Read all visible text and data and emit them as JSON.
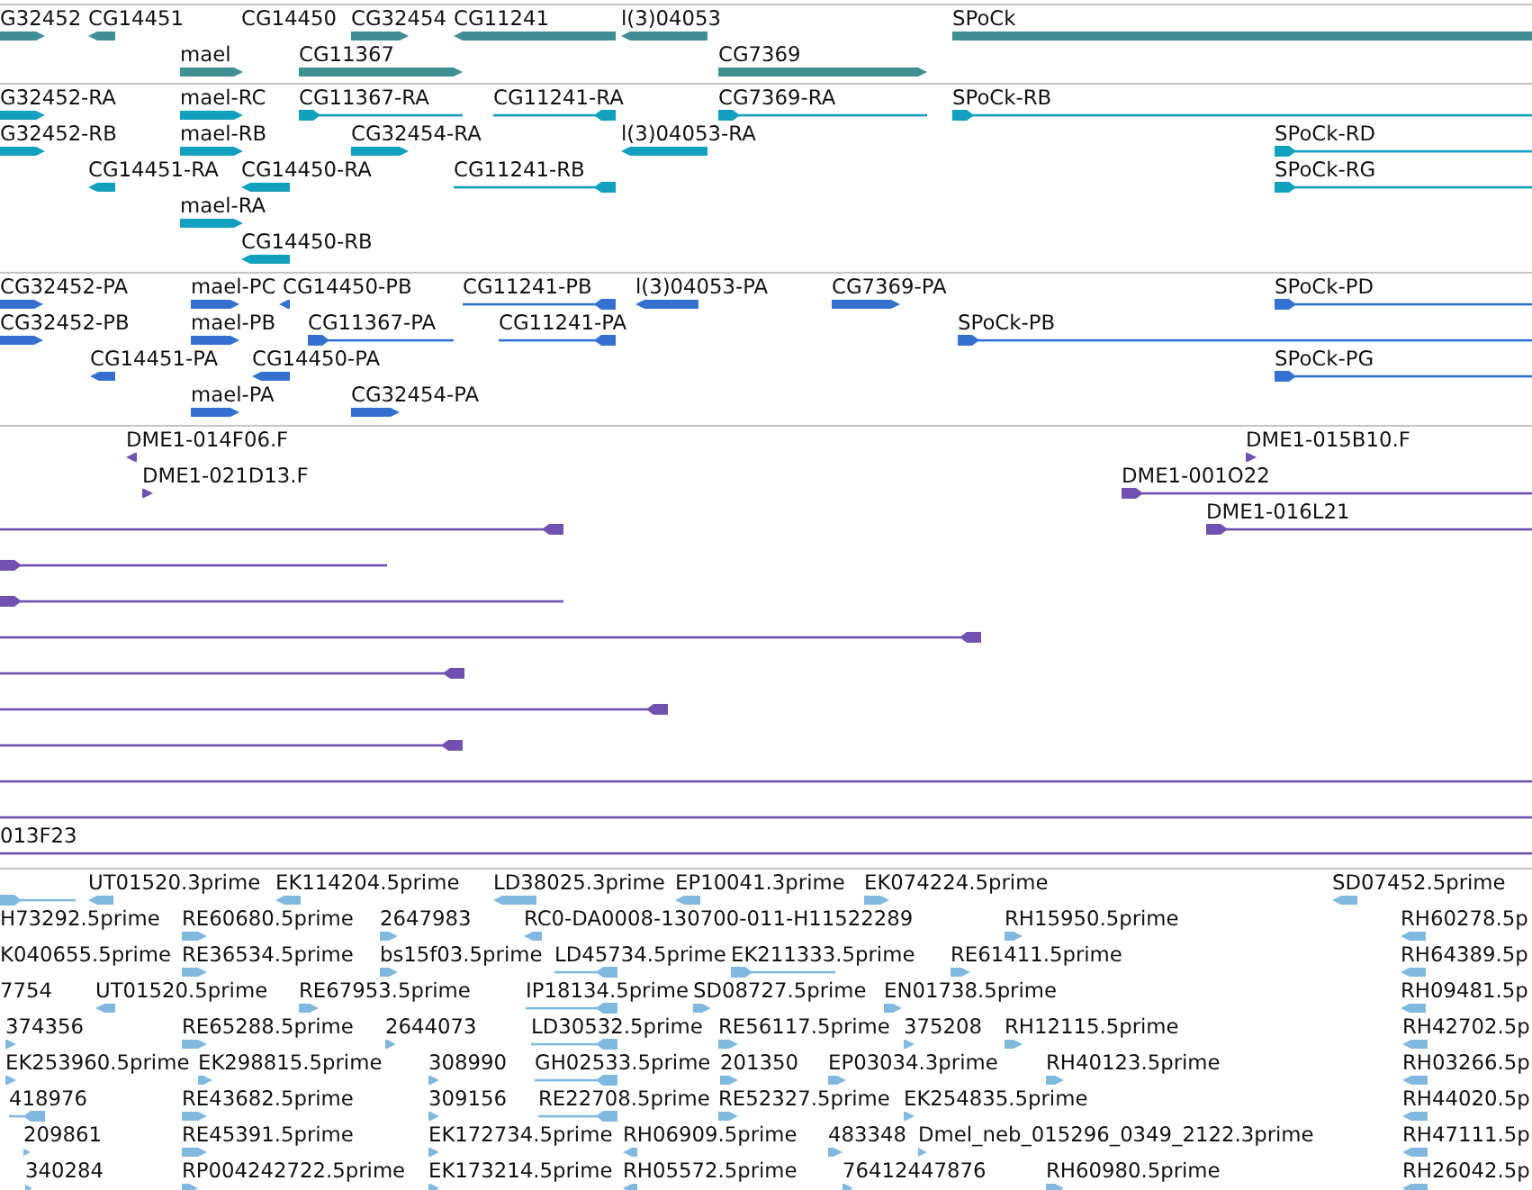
{
  "tracks": [
    {
      "color": "#3f8f94",
      "features": [
        {
          "label": "G32452"
        },
        {
          "label": "CG14451"
        },
        {
          "label": "CG14450"
        },
        {
          "label": "CG32454"
        },
        {
          "label": "CG11241"
        },
        {
          "label": "l(3)04053"
        },
        {
          "label": "SPoCk"
        },
        {
          "label": "mael"
        },
        {
          "label": "CG11367"
        },
        {
          "label": "CG7369"
        }
      ]
    },
    {
      "color": "#12a0bf",
      "features": [
        {
          "label": "G32452-RA"
        },
        {
          "label": "mael-RC"
        },
        {
          "label": "CG11367-RA"
        },
        {
          "label": "CG11241-RA"
        },
        {
          "label": "CG7369-RA"
        },
        {
          "label": "SPoCk-RB"
        },
        {
          "label": "G32452-RB"
        },
        {
          "label": "mael-RB"
        },
        {
          "label": "CG32454-RA"
        },
        {
          "label": "l(3)04053-RA"
        },
        {
          "label": "SPoCk-RD"
        },
        {
          "label": "CG14451-RA"
        },
        {
          "label": "CG14450-RA"
        },
        {
          "label": "CG11241-RB"
        },
        {
          "label": "SPoCk-RG"
        },
        {
          "label": "mael-RA"
        },
        {
          "label": "CG14450-RB"
        }
      ]
    },
    {
      "color": "#3370d0",
      "features": [
        {
          "label": "CG32452-PA"
        },
        {
          "label": "mael-PC"
        },
        {
          "label": "CG14450-PB"
        },
        {
          "label": "CG11241-PB"
        },
        {
          "label": "l(3)04053-PA"
        },
        {
          "label": "CG7369-PA"
        },
        {
          "label": "SPoCk-PD"
        },
        {
          "label": "CG32452-PB"
        },
        {
          "label": "mael-PB"
        },
        {
          "label": "CG11367-PA"
        },
        {
          "label": "CG11241-PA"
        },
        {
          "label": "SPoCk-PB"
        },
        {
          "label": "CG14451-PA"
        },
        {
          "label": "CG14450-PA"
        },
        {
          "label": "SPoCk-PG"
        },
        {
          "label": "mael-PA"
        },
        {
          "label": "CG32454-PA"
        }
      ]
    },
    {
      "color": "#7050b0",
      "features": [
        {
          "label": "DME1-014F06.F"
        },
        {
          "label": "DME1-015B10.F"
        },
        {
          "label": "DME1-021D13.F"
        },
        {
          "label": "DME1-001O22"
        },
        {
          "label": "DME1-016L21"
        },
        {
          "label": "013F23"
        }
      ]
    },
    {
      "color": "#80b8e0",
      "features": [
        {
          "label": "UT01520.3prime"
        },
        {
          "label": "EK114204.5prime"
        },
        {
          "label": "LD38025.3prime"
        },
        {
          "label": "EP10041.3prime"
        },
        {
          "label": "EK074224.5prime"
        },
        {
          "label": "SD07452.5prime"
        },
        {
          "label": "H73292.5prime"
        },
        {
          "label": "RE60680.5prime"
        },
        {
          "label": "2647983"
        },
        {
          "label": "RC0-DA0008-130700-011-H11522289"
        },
        {
          "label": "RH15950.5prime"
        },
        {
          "label": "RH60278.5p"
        },
        {
          "label": "K040655.5prime"
        },
        {
          "label": "RE36534.5prime"
        },
        {
          "label": "bs15f03.5prime"
        },
        {
          "label": "LD45734.5prime"
        },
        {
          "label": "EK211333.5prime"
        },
        {
          "label": "RE61411.5prime"
        },
        {
          "label": "RH64389.5p"
        },
        {
          "label": "7754"
        },
        {
          "label": "UT01520.5prime"
        },
        {
          "label": "RE67953.5prime"
        },
        {
          "label": "IP18134.5prime"
        },
        {
          "label": "SD08727.5prime"
        },
        {
          "label": "EN01738.5prime"
        },
        {
          "label": "RH09481.5p"
        },
        {
          "label": "374356"
        },
        {
          "label": "RE65288.5prime"
        },
        {
          "label": "2644073"
        },
        {
          "label": "LD30532.5prime"
        },
        {
          "label": "RE56117.5prime"
        },
        {
          "label": "375208"
        },
        {
          "label": "RH12115.5prime"
        },
        {
          "label": "RH42702.5p"
        },
        {
          "label": "EK253960.5prime"
        },
        {
          "label": "EK298815.5prime"
        },
        {
          "label": "308990"
        },
        {
          "label": "GH02533.5prime"
        },
        {
          "label": "201350"
        },
        {
          "label": "EP03034.3prime"
        },
        {
          "label": "RH40123.5prime"
        },
        {
          "label": "RH03266.5p"
        },
        {
          "label": "418976"
        },
        {
          "label": "RE43682.5prime"
        },
        {
          "label": "309156"
        },
        {
          "label": "RE22708.5prime"
        },
        {
          "label": "RE52327.5prime"
        },
        {
          "label": "EK254835.5prime"
        },
        {
          "label": "RH44020.5p"
        },
        {
          "label": "209861"
        },
        {
          "label": "RE45391.5prime"
        },
        {
          "label": "EK172734.5prime"
        },
        {
          "label": "RH06909.5prime"
        },
        {
          "label": "483348"
        },
        {
          "label": "Dmel_neb_015296_0349_2122.3prime"
        },
        {
          "label": "RH47111.5p"
        },
        {
          "label": "340284"
        },
        {
          "label": "RP004242722.5prime"
        },
        {
          "label": "EK173214.5prime"
        },
        {
          "label": "RH05572.5prime"
        },
        {
          "label": "76412447876"
        },
        {
          "label": "RH60980.5prime"
        },
        {
          "label": "RH26042.5p"
        }
      ]
    }
  ]
}
